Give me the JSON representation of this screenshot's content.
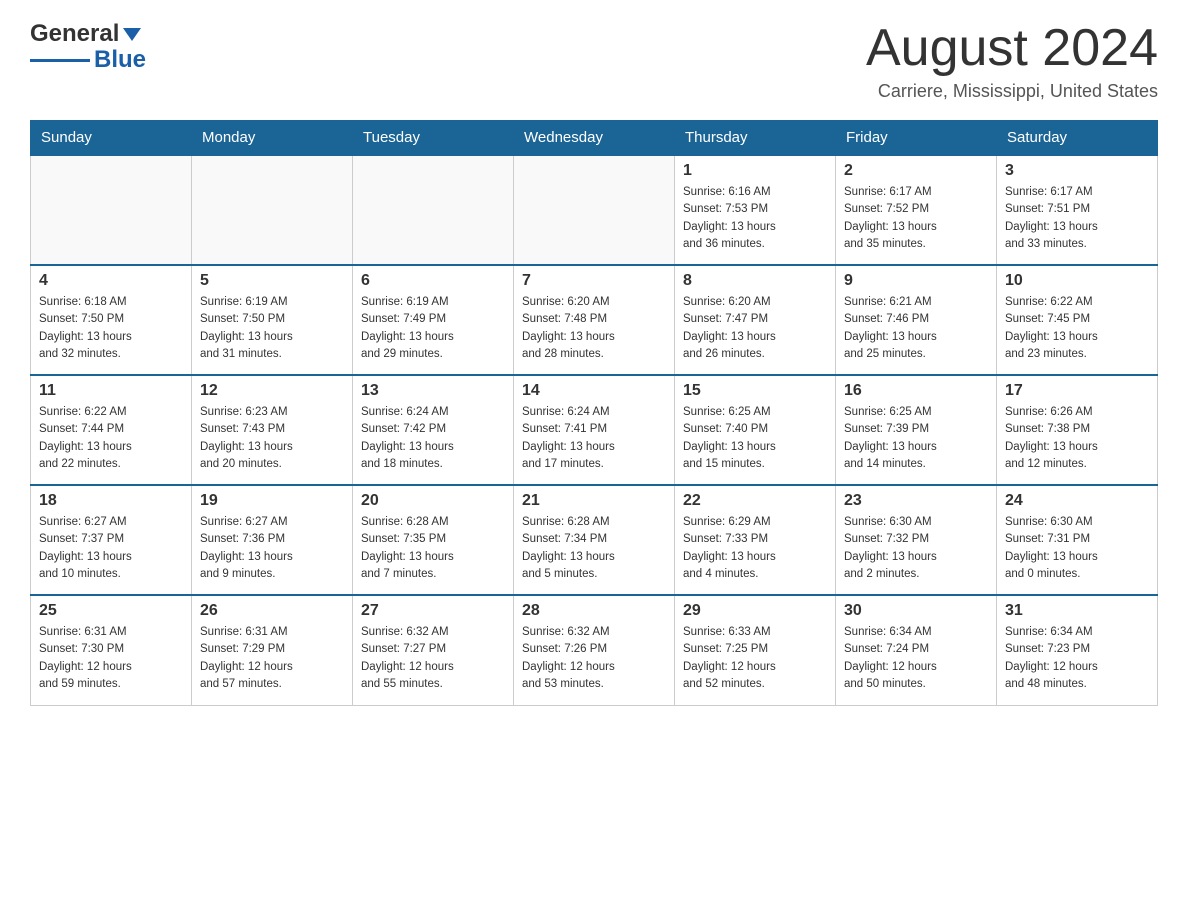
{
  "header": {
    "logo_general": "General",
    "logo_blue": "Blue",
    "month_title": "August 2024",
    "location": "Carriere, Mississippi, United States"
  },
  "weekdays": [
    "Sunday",
    "Monday",
    "Tuesday",
    "Wednesday",
    "Thursday",
    "Friday",
    "Saturday"
  ],
  "weeks": [
    [
      {
        "day": "",
        "info": ""
      },
      {
        "day": "",
        "info": ""
      },
      {
        "day": "",
        "info": ""
      },
      {
        "day": "",
        "info": ""
      },
      {
        "day": "1",
        "info": "Sunrise: 6:16 AM\nSunset: 7:53 PM\nDaylight: 13 hours\nand 36 minutes."
      },
      {
        "day": "2",
        "info": "Sunrise: 6:17 AM\nSunset: 7:52 PM\nDaylight: 13 hours\nand 35 minutes."
      },
      {
        "day": "3",
        "info": "Sunrise: 6:17 AM\nSunset: 7:51 PM\nDaylight: 13 hours\nand 33 minutes."
      }
    ],
    [
      {
        "day": "4",
        "info": "Sunrise: 6:18 AM\nSunset: 7:50 PM\nDaylight: 13 hours\nand 32 minutes."
      },
      {
        "day": "5",
        "info": "Sunrise: 6:19 AM\nSunset: 7:50 PM\nDaylight: 13 hours\nand 31 minutes."
      },
      {
        "day": "6",
        "info": "Sunrise: 6:19 AM\nSunset: 7:49 PM\nDaylight: 13 hours\nand 29 minutes."
      },
      {
        "day": "7",
        "info": "Sunrise: 6:20 AM\nSunset: 7:48 PM\nDaylight: 13 hours\nand 28 minutes."
      },
      {
        "day": "8",
        "info": "Sunrise: 6:20 AM\nSunset: 7:47 PM\nDaylight: 13 hours\nand 26 minutes."
      },
      {
        "day": "9",
        "info": "Sunrise: 6:21 AM\nSunset: 7:46 PM\nDaylight: 13 hours\nand 25 minutes."
      },
      {
        "day": "10",
        "info": "Sunrise: 6:22 AM\nSunset: 7:45 PM\nDaylight: 13 hours\nand 23 minutes."
      }
    ],
    [
      {
        "day": "11",
        "info": "Sunrise: 6:22 AM\nSunset: 7:44 PM\nDaylight: 13 hours\nand 22 minutes."
      },
      {
        "day": "12",
        "info": "Sunrise: 6:23 AM\nSunset: 7:43 PM\nDaylight: 13 hours\nand 20 minutes."
      },
      {
        "day": "13",
        "info": "Sunrise: 6:24 AM\nSunset: 7:42 PM\nDaylight: 13 hours\nand 18 minutes."
      },
      {
        "day": "14",
        "info": "Sunrise: 6:24 AM\nSunset: 7:41 PM\nDaylight: 13 hours\nand 17 minutes."
      },
      {
        "day": "15",
        "info": "Sunrise: 6:25 AM\nSunset: 7:40 PM\nDaylight: 13 hours\nand 15 minutes."
      },
      {
        "day": "16",
        "info": "Sunrise: 6:25 AM\nSunset: 7:39 PM\nDaylight: 13 hours\nand 14 minutes."
      },
      {
        "day": "17",
        "info": "Sunrise: 6:26 AM\nSunset: 7:38 PM\nDaylight: 13 hours\nand 12 minutes."
      }
    ],
    [
      {
        "day": "18",
        "info": "Sunrise: 6:27 AM\nSunset: 7:37 PM\nDaylight: 13 hours\nand 10 minutes."
      },
      {
        "day": "19",
        "info": "Sunrise: 6:27 AM\nSunset: 7:36 PM\nDaylight: 13 hours\nand 9 minutes."
      },
      {
        "day": "20",
        "info": "Sunrise: 6:28 AM\nSunset: 7:35 PM\nDaylight: 13 hours\nand 7 minutes."
      },
      {
        "day": "21",
        "info": "Sunrise: 6:28 AM\nSunset: 7:34 PM\nDaylight: 13 hours\nand 5 minutes."
      },
      {
        "day": "22",
        "info": "Sunrise: 6:29 AM\nSunset: 7:33 PM\nDaylight: 13 hours\nand 4 minutes."
      },
      {
        "day": "23",
        "info": "Sunrise: 6:30 AM\nSunset: 7:32 PM\nDaylight: 13 hours\nand 2 minutes."
      },
      {
        "day": "24",
        "info": "Sunrise: 6:30 AM\nSunset: 7:31 PM\nDaylight: 13 hours\nand 0 minutes."
      }
    ],
    [
      {
        "day": "25",
        "info": "Sunrise: 6:31 AM\nSunset: 7:30 PM\nDaylight: 12 hours\nand 59 minutes."
      },
      {
        "day": "26",
        "info": "Sunrise: 6:31 AM\nSunset: 7:29 PM\nDaylight: 12 hours\nand 57 minutes."
      },
      {
        "day": "27",
        "info": "Sunrise: 6:32 AM\nSunset: 7:27 PM\nDaylight: 12 hours\nand 55 minutes."
      },
      {
        "day": "28",
        "info": "Sunrise: 6:32 AM\nSunset: 7:26 PM\nDaylight: 12 hours\nand 53 minutes."
      },
      {
        "day": "29",
        "info": "Sunrise: 6:33 AM\nSunset: 7:25 PM\nDaylight: 12 hours\nand 52 minutes."
      },
      {
        "day": "30",
        "info": "Sunrise: 6:34 AM\nSunset: 7:24 PM\nDaylight: 12 hours\nand 50 minutes."
      },
      {
        "day": "31",
        "info": "Sunrise: 6:34 AM\nSunset: 7:23 PM\nDaylight: 12 hours\nand 48 minutes."
      }
    ]
  ]
}
